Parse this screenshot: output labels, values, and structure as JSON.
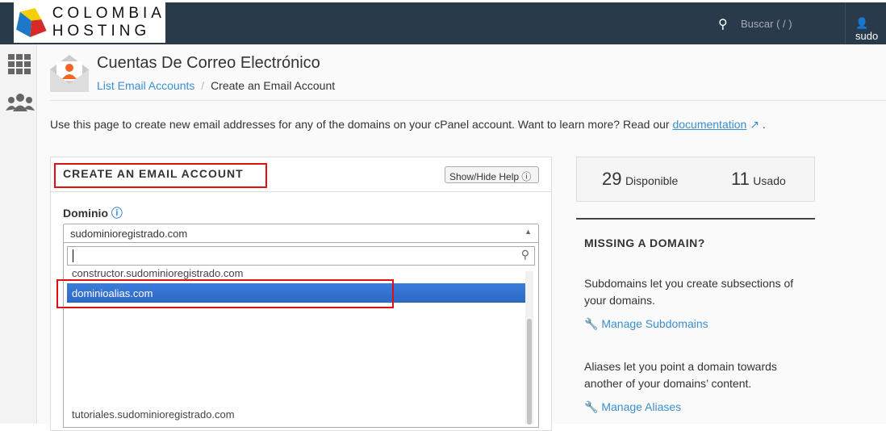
{
  "topbar": {
    "logo_text": [
      "COLOMBIA",
      "HOSTING"
    ],
    "search_placeholder": "Buscar ( / )",
    "user": "sudo"
  },
  "header": {
    "title": "Cuentas De Correo Electrónico",
    "breadcrumb": {
      "link": "List Email Accounts",
      "separator": "/",
      "current": "Create an Email Account"
    }
  },
  "description": {
    "text": "Use this page to create new email addresses for any of the domains on your cPanel account. Want to learn more? Read our ",
    "link": "documentation",
    "end": " ."
  },
  "panel": {
    "title": "CREATE AN EMAIL ACCOUNT",
    "help_button": "Show/Hide Help",
    "domain_label": "Dominio",
    "selected": "sudominioregistrado.com",
    "options": [
      "constructor.sudominioregistrado.com",
      "dominioalias.com",
      "tutoriales.sudominioregistrado.com"
    ]
  },
  "stats": {
    "available_num": "29",
    "available_label": "Disponible",
    "used_num": "11",
    "used_label": "Usado"
  },
  "missing": {
    "title": "MISSING A DOMAIN?",
    "sub_text": "Subdomains let you create subsections of your domains.",
    "sub_link": "Manage Subdomains",
    "alias_text": "Aliases let you point a domain towards another of your domains’ content.",
    "alias_link": "Manage Aliases"
  },
  "colors": {
    "topbar": "#293a4a",
    "link": "#3b8ed0",
    "highlight": "#3372d0",
    "annotation": "#e01010"
  }
}
